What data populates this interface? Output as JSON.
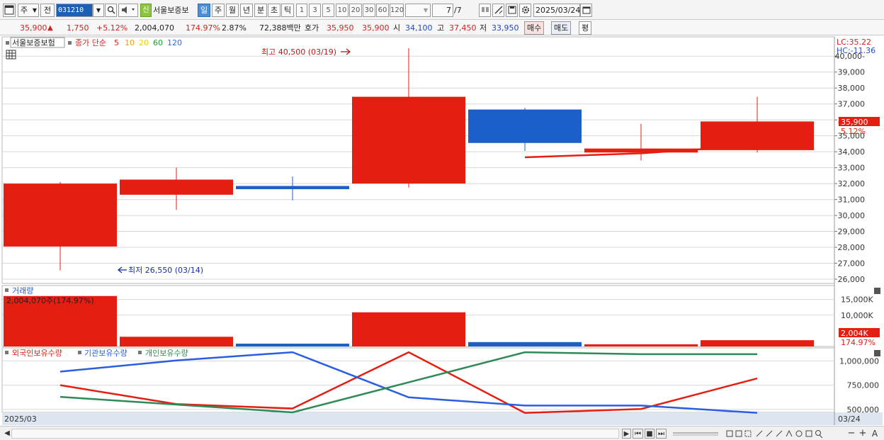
{
  "toolbar": {
    "menu_icon": "window-menu-icon",
    "period_type": "주",
    "prev_label": "전",
    "stock_code": "031210",
    "stock_name": "서울보증보",
    "new_badge": "신",
    "intervals": [
      "일",
      "주",
      "월",
      "년",
      "분",
      "초",
      "틱"
    ],
    "selected_interval": "일",
    "numbers": [
      "1",
      "3",
      "5",
      "10",
      "20",
      "30",
      "60",
      "120"
    ],
    "count_value": "7",
    "count_total": "/7",
    "date": "2025/03/24"
  },
  "quote": {
    "price": "35,900",
    "change_arrow": "▲",
    "change": "1,750",
    "change_pct": "+5.12%",
    "volume": "2,004,070",
    "vol_ratio": "174.97%",
    "turnover_pct": "2.87%",
    "amount": "72,388백만",
    "ask_label": "호가",
    "ask": "35,950",
    "bid": "35,900",
    "open_label": "시",
    "open": "34,100",
    "high_label": "고",
    "high": "37,450",
    "low_label": "저",
    "low": "33,950",
    "buy_label": "매수",
    "sell_label": "매도",
    "eval_label": "평"
  },
  "chart": {
    "name_label": "서울보증보험",
    "ma_label": "종가 단순",
    "ma_periods": [
      {
        "label": "5",
        "color": "#e02020"
      },
      {
        "label": "10",
        "color": "#e8a000"
      },
      {
        "label": "20",
        "color": "#e8d000"
      },
      {
        "label": "60",
        "color": "#1a9a30"
      },
      {
        "label": "120",
        "color": "#2a6ad8"
      }
    ],
    "lc_label": "LC:35.22",
    "hc_label": "HC:-11.36",
    "high_annotation": "최고 40,500 (03/19)",
    "low_annotation": "최저 26,550 (03/14)",
    "last_price_tag": "35,900",
    "last_pct_tag": "5.12%",
    "volume_label": "거래량",
    "volume_value": "2,004,070주(174.97%)",
    "volume_tag": "2,004K",
    "volume_pct_tag": "174.97%",
    "bottom_date_left": "2025/03",
    "bottom_date_right": "03/24",
    "holdings_legend": [
      "외국인보유수량",
      "기관보유수량",
      "개인보유수량"
    ]
  },
  "chart_data": [
    {
      "type": "candlestick",
      "title": "서울보증보험",
      "ylim": [
        26000,
        40500
      ],
      "yticks": [
        26000,
        27000,
        28000,
        29000,
        30000,
        31000,
        32000,
        33000,
        34000,
        35000,
        36000,
        37000,
        38000,
        39000,
        40000
      ],
      "candles": [
        {
          "open": 32000,
          "close": 28050,
          "high": 32100,
          "low": 26550,
          "up": false,
          "color": "#e41e10"
        },
        {
          "open": 31300,
          "close": 32250,
          "high": 33000,
          "low": 30350,
          "up": true,
          "color": "#e41e10"
        },
        {
          "open": 31850,
          "close": 31650,
          "high": 32450,
          "low": 30950,
          "up": false,
          "color": "#1c5fc8"
        },
        {
          "open": 32000,
          "close": 37450,
          "high": 40500,
          "low": 31750,
          "up": true,
          "color": "#e41e10"
        },
        {
          "open": 36650,
          "close": 34550,
          "high": 36750,
          "low": 34050,
          "up": false,
          "color": "#1c5fc8"
        },
        {
          "open": 33950,
          "close": 34200,
          "high": 35750,
          "low": 33450,
          "up": true,
          "color": "#e41e10"
        },
        {
          "open": 34100,
          "close": 35900,
          "high": 37450,
          "low": 33950,
          "up": true,
          "color": "#e41e10"
        }
      ],
      "ma5": [
        {
          "i": 4,
          "v": 33650
        },
        {
          "i": 5,
          "v": 33900
        },
        {
          "i": 6,
          "v": 34400
        }
      ]
    },
    {
      "type": "bar",
      "title": "거래량",
      "ylim": [
        0,
        16500
      ],
      "yticks": [
        10000,
        15000
      ],
      "ytick_labels": [
        "10,000K",
        "15,000K"
      ],
      "values": [
        16100,
        3100,
        900,
        10900,
        1400,
        700,
        2004
      ],
      "colors": [
        "#e41e10",
        "#e41e10",
        "#1c5fc8",
        "#e41e10",
        "#1c5fc8",
        "#e41e10",
        "#e41e10"
      ]
    },
    {
      "type": "line",
      "ylim": [
        470000,
        1120000
      ],
      "yticks": [
        500000,
        750000,
        1000000
      ],
      "ytick_labels": [
        "500,000",
        "750,000",
        "1,000,000"
      ],
      "series": [
        {
          "name": "외국인보유수량",
          "color": "#e41e10",
          "values": [
            750000,
            555000,
            510000,
            1090000,
            465000,
            505000,
            820000
          ]
        },
        {
          "name": "기관보유수량",
          "color": "#2a5ee0",
          "values": [
            890000,
            1005000,
            1090000,
            625000,
            540000,
            540000,
            465000
          ]
        },
        {
          "name": "개인보유수량",
          "color": "#2e8a56",
          "values": [
            630000,
            550000,
            470000,
            780000,
            1090000,
            1070000,
            1070000
          ]
        }
      ]
    }
  ],
  "scroll": {
    "btn_play": "▶",
    "btn_first": "⏮",
    "btn_stop": "■",
    "btn_last": "⏭",
    "zoom_out": "−",
    "zoom_in": "+",
    "auto": "A"
  }
}
